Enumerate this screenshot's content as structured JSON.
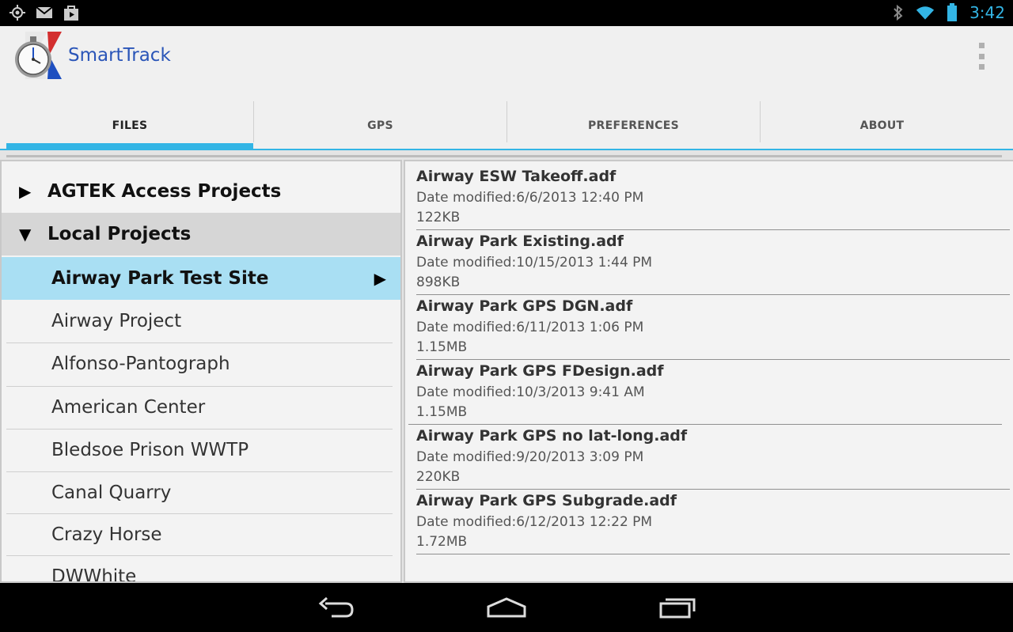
{
  "status_bar": {
    "time": "3:42",
    "left_icons": [
      "gps-icon",
      "gmail-icon",
      "play-store-icon"
    ],
    "right_icons": [
      "bluetooth-icon",
      "wifi-icon",
      "battery-icon"
    ]
  },
  "app": {
    "title": "SmartTrack",
    "accent_color": "#33b5e5",
    "title_color": "#2a55b8"
  },
  "tabs": [
    {
      "label": "FILES",
      "active": true
    },
    {
      "label": "GPS",
      "active": false
    },
    {
      "label": "PREFERENCES",
      "active": false
    },
    {
      "label": "ABOUT",
      "active": false
    }
  ],
  "groups": [
    {
      "label": "AGTEK Access Projects",
      "expanded": false
    },
    {
      "label": "Local Projects",
      "expanded": true
    }
  ],
  "projects": [
    {
      "label": "Airway Park Test Site",
      "selected": true
    },
    {
      "label": "Airway Project",
      "selected": false
    },
    {
      "label": "Alfonso-Pantograph",
      "selected": false
    },
    {
      "label": "American Center",
      "selected": false
    },
    {
      "label": "Bledsoe Prison WWTP",
      "selected": false
    },
    {
      "label": "Canal Quarry",
      "selected": false
    },
    {
      "label": "Crazy Horse",
      "selected": false
    },
    {
      "label": "DWWhite",
      "selected": false
    }
  ],
  "files": [
    {
      "name": "Airway ESW Takeoff.adf",
      "date": "Date modified:6/6/2013 12:40 PM",
      "size": "122KB"
    },
    {
      "name": "Airway Park Existing.adf",
      "date": "Date modified:10/15/2013 1:44 PM",
      "size": "898KB"
    },
    {
      "name": "Airway Park GPS DGN.adf",
      "date": "Date modified:6/11/2013 1:06 PM",
      "size": "1.15MB"
    },
    {
      "name": "Airway Park GPS FDesign.adf",
      "date": "Date modified:10/3/2013 9:41 AM",
      "size": "1.15MB"
    },
    {
      "name": "Airway Park GPS no lat-long.adf",
      "date": "Date modified:9/20/2013 3:09 PM",
      "size": "220KB"
    },
    {
      "name": "Airway Park GPS Subgrade.adf",
      "date": "Date modified:6/12/2013 12:22 PM",
      "size": "1.72MB"
    }
  ],
  "nav_bar": {
    "icons": [
      "back-icon",
      "home-icon",
      "recent-apps-icon"
    ]
  }
}
